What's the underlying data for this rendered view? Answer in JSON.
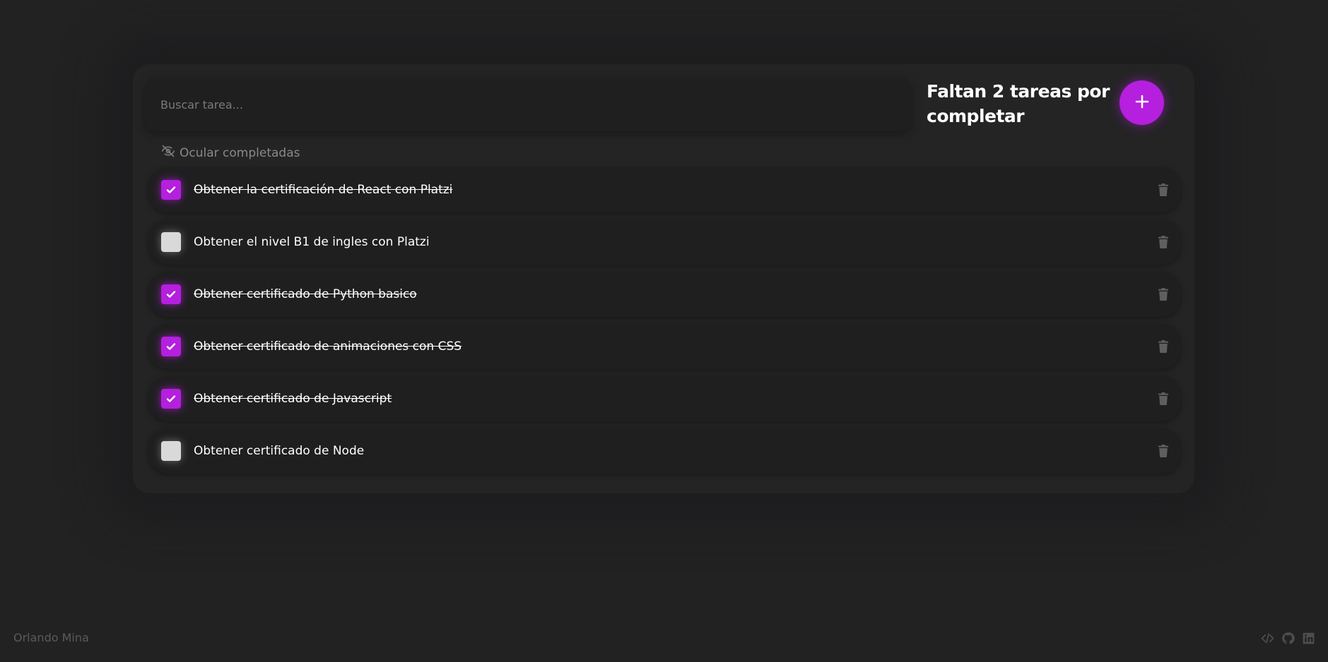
{
  "search": {
    "placeholder": "Buscar tarea..."
  },
  "counter": {
    "text": "Faltan 2 tareas por completar"
  },
  "add_button": {
    "icon": "plus-icon"
  },
  "toggle": {
    "label": "Ocular completadas",
    "icon": "eye-slash-icon"
  },
  "todos": [
    {
      "text": "Obtener la certificación de React con Platzi",
      "completed": true
    },
    {
      "text": "Obtener el nivel B1 de ingles con Platzi",
      "completed": false
    },
    {
      "text": "Obtener certificado de Python basico",
      "completed": true
    },
    {
      "text": "Obtener certificado de animaciones con CSS",
      "completed": true
    },
    {
      "text": "Obtener certificado de Javascript",
      "completed": true
    },
    {
      "text": "Obtener certificado de Node",
      "completed": false
    }
  ],
  "footer": {
    "author": "Orlando Mina",
    "links": [
      "code-icon",
      "github-icon",
      "linkedin-icon"
    ]
  },
  "colors": {
    "accent": "#b51fde",
    "background": "#222223",
    "surface": "#1f1f20",
    "pending_check": "#d9d9d9"
  }
}
